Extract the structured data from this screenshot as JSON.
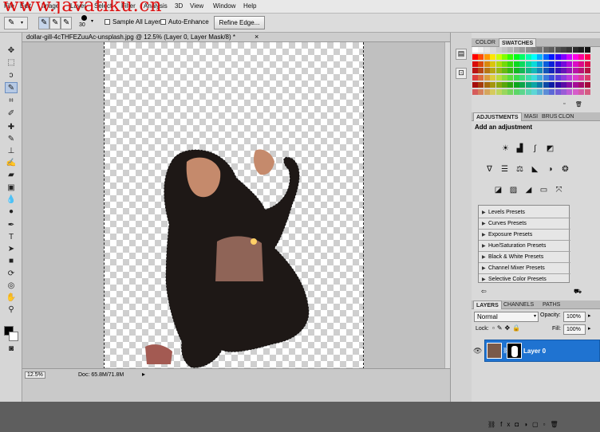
{
  "menu": {
    "watermark": "www.javatiku.cn",
    "items": [
      "File",
      "Edit",
      "Image",
      "Layer",
      "Select",
      "Filter",
      "Analysis",
      "3D",
      "View",
      "Window",
      "Help"
    ]
  },
  "options": {
    "brush_size": "30",
    "sample_all_layers": "Sample All Layers",
    "auto_enhance": "Auto-Enhance",
    "refine_edge": "Refine Edge..."
  },
  "document": {
    "tab_title": "dollar-gill-4cTHFEZuuAc-unsplash.jpg @ 12.5% (Layer 0, Layer Mask/8) *",
    "close_glyph": "×",
    "zoom": "12.5%",
    "doc_size": "Doc: 65.8M/71.8M"
  },
  "color_panel": {
    "tabs": [
      "COLOR",
      "SWATCHES"
    ],
    "active_tab": "SWATCHES"
  },
  "adjustments_panel": {
    "tabs": [
      "ADJUSTMENTS",
      "MASI",
      "BRUS",
      "CLON"
    ],
    "active_tab": "ADJUSTMENTS",
    "heading": "Add an adjustment",
    "presets": [
      "Levels Presets",
      "Curves Presets",
      "Exposure Presets",
      "Hue/Saturation Presets",
      "Black & White Presets",
      "Channel Mixer Presets",
      "Selective Color Presets"
    ]
  },
  "layers_panel": {
    "tabs": [
      "LAYERS",
      "CHANNELS",
      "PATHS"
    ],
    "active_tab": "LAYERS",
    "blend_mode": "Normal",
    "opacity_label": "Opacity:",
    "opacity_value": "100%",
    "lock_label": "Lock:",
    "fill_label": "Fill:",
    "fill_value": "100%",
    "layer_name": "Layer 0"
  },
  "colors": {
    "selected_layer": "#1f73d1",
    "tool_highlight": "#b6c9e4"
  }
}
